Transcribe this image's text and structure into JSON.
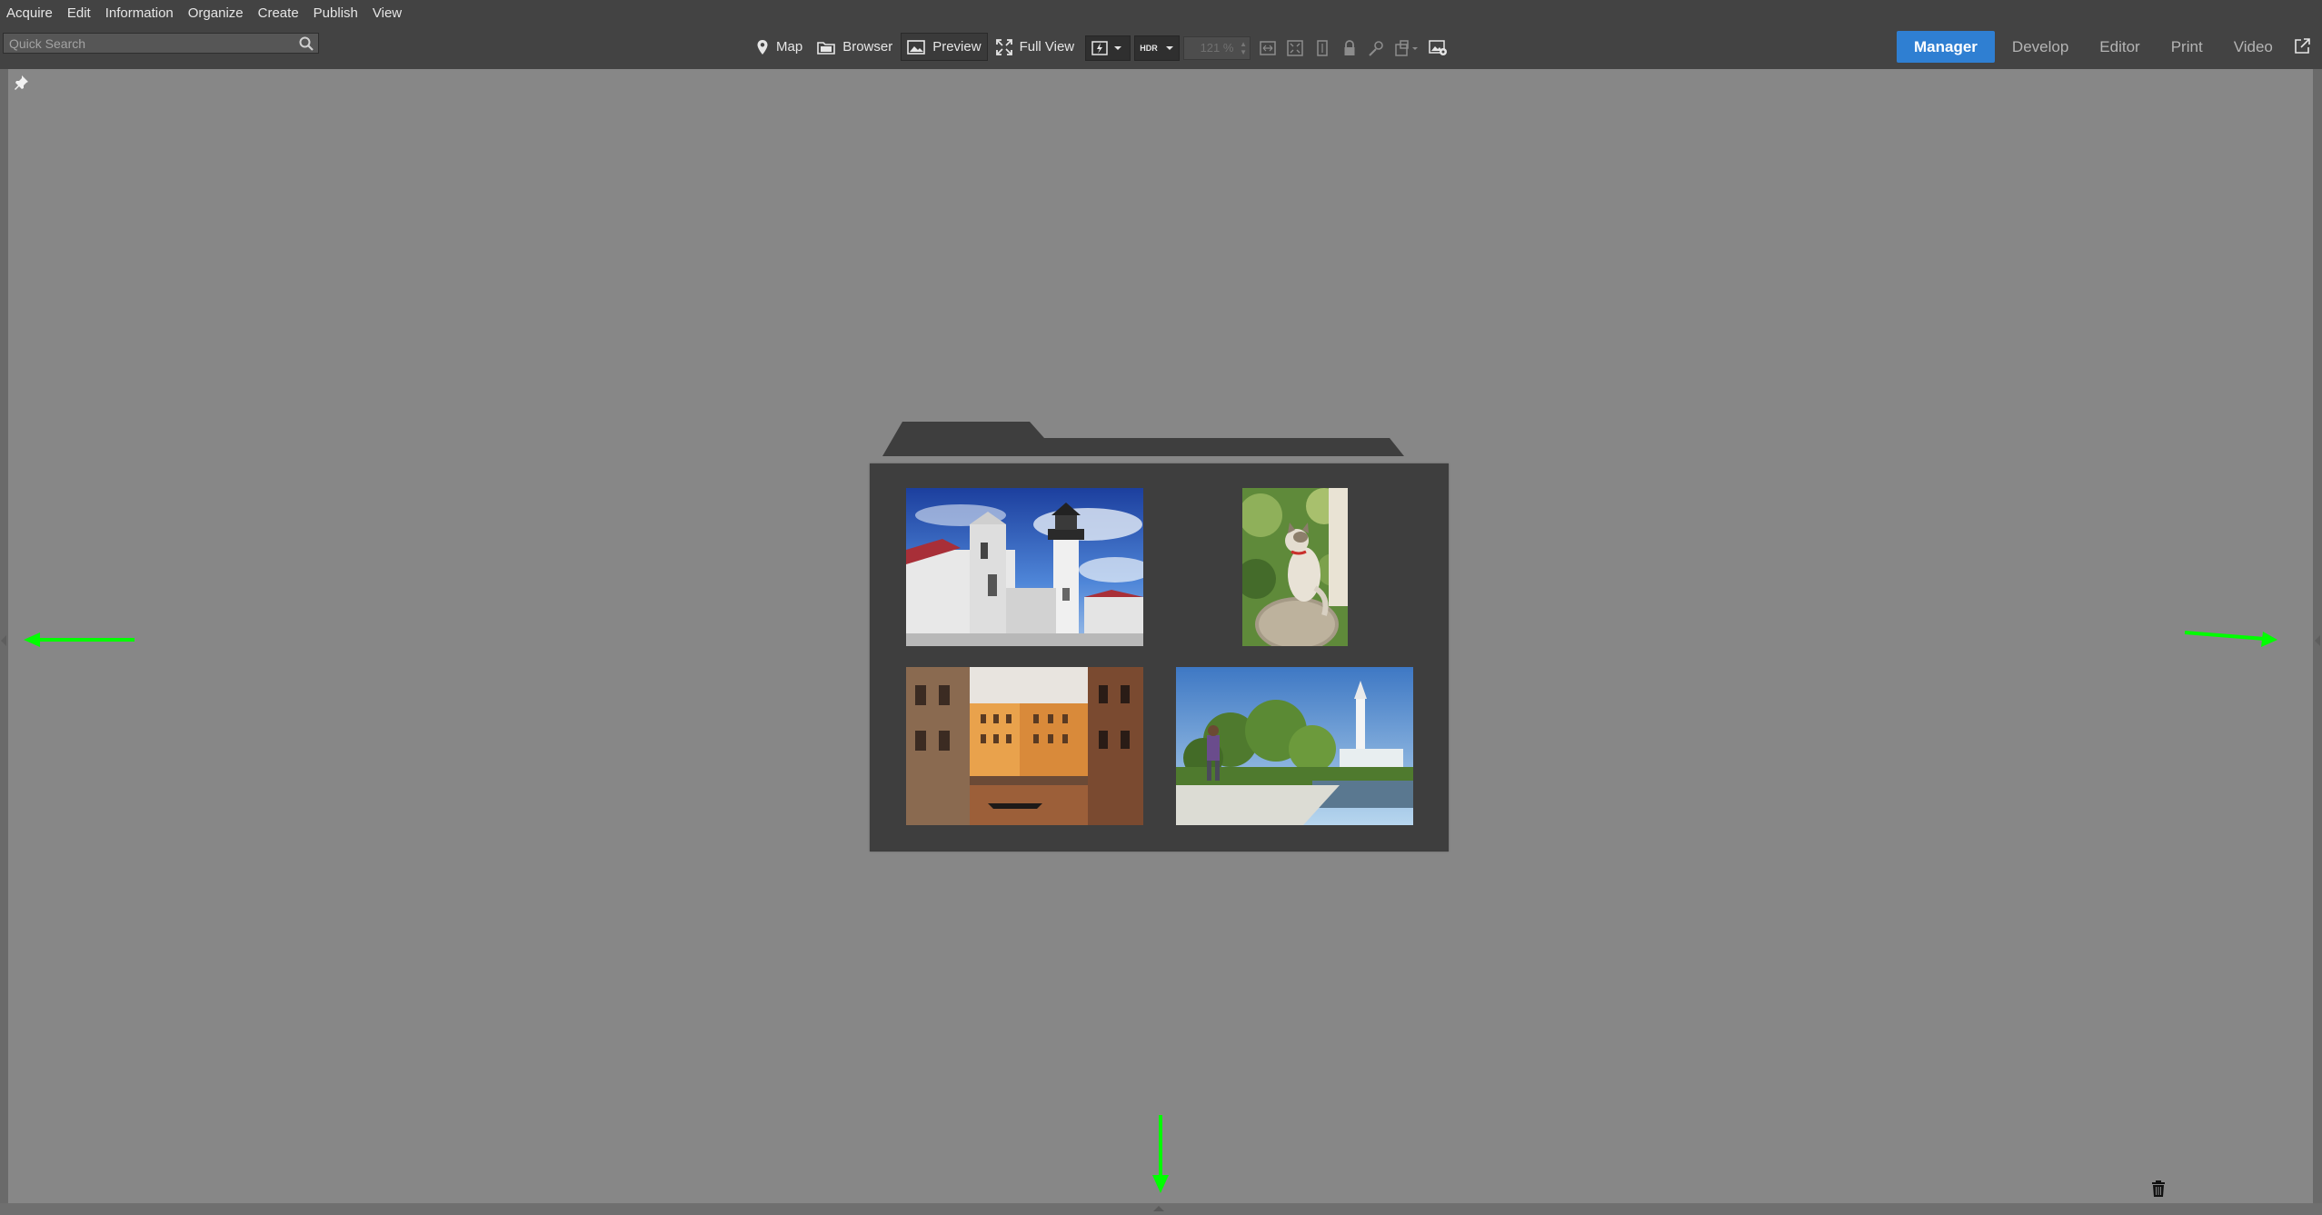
{
  "menu": {
    "items": [
      "Acquire",
      "Edit",
      "Information",
      "Organize",
      "Create",
      "Publish",
      "View"
    ]
  },
  "search": {
    "placeholder": "Quick Search"
  },
  "view_modes": [
    {
      "label": "Map",
      "icon": "map-pin-icon",
      "active": false
    },
    {
      "label": "Browser",
      "icon": "folder-icon",
      "active": false
    },
    {
      "label": "Preview",
      "icon": "image-icon",
      "active": true
    },
    {
      "label": "Full View",
      "icon": "expand-icon",
      "active": false
    }
  ],
  "toolbar": {
    "hdr_label": "HDR",
    "zoom_value": "121 %"
  },
  "modules": [
    {
      "label": "Manager",
      "active": true
    },
    {
      "label": "Develop",
      "active": false
    },
    {
      "label": "Editor",
      "active": false
    },
    {
      "label": "Print",
      "active": false
    },
    {
      "label": "Video",
      "active": false
    }
  ],
  "folder_preview": {
    "thumbnails": [
      {
        "name": "lighthouse-thumbnail",
        "subject": "lighthouse"
      },
      {
        "name": "cat-thumbnail",
        "subject": "cat"
      },
      {
        "name": "canal-thumbnail",
        "subject": "canal"
      },
      {
        "name": "park-thumbnail",
        "subject": "park"
      }
    ]
  },
  "colors": {
    "accent": "#2f7fd2",
    "chrome": "#434343",
    "workspace": "#878787",
    "folder": "#3e3e3e",
    "annotation_arrow": "#00ff00"
  }
}
